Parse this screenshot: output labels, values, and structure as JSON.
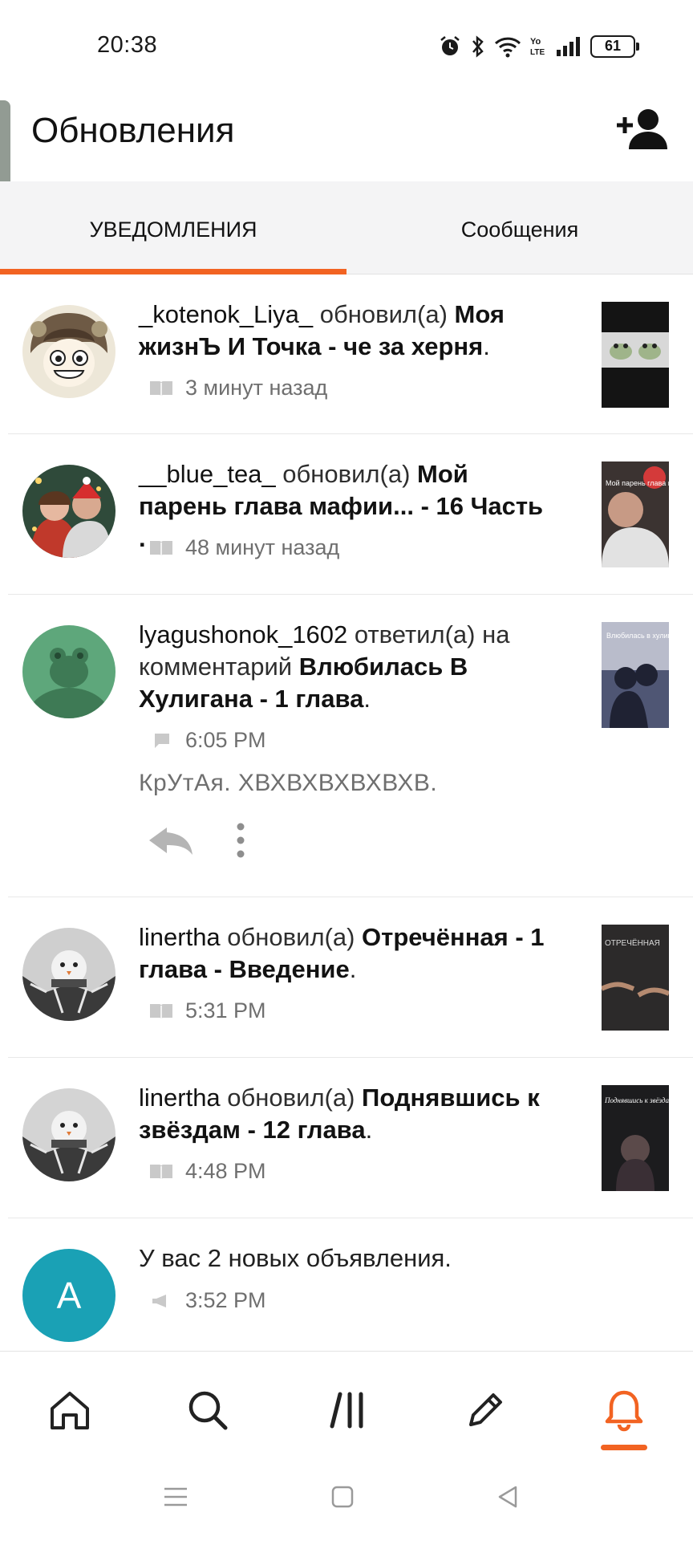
{
  "status_bar": {
    "time": "20:38",
    "battery": "61",
    "icons": [
      "alarm-icon",
      "bluetooth-icon",
      "wifi-icon",
      "volte-icon",
      "signal-icon",
      "battery-icon"
    ]
  },
  "header": {
    "title": "Обновления",
    "action_icon": "add-friend-icon"
  },
  "tabs": [
    {
      "label": "УВЕДОМЛЕНИЯ",
      "active": true
    },
    {
      "label": "Сообщения",
      "active": false
    }
  ],
  "notifications": [
    {
      "user": "_kotenok_Liya_",
      "action": " обновил(а) ",
      "story": "Моя жизнЪ И Точка - че за херня",
      "tail": ".",
      "time": "3 минут назад",
      "meta_icon": "book-icon"
    },
    {
      "user": "__blue_tea_",
      "action": " обновил(а) ",
      "story": "Мой парень глава мафии... - 16 Часть .",
      "tail": "",
      "time": "48 минут назад",
      "meta_icon": "book-icon"
    },
    {
      "user": "lyagushonok_1602",
      "action": " ответил(а) на комментарий ",
      "story": "Влюбилась В Хулигана - 1 глава",
      "tail": ".",
      "time": "6:05 PM",
      "meta_icon": "comment-icon",
      "comment": "КрУтАя. ХВХВХВХВХВХВ."
    },
    {
      "user": "linertha",
      "action": " обновил(а) ",
      "story": "Отречённая - 1 глава - Введение",
      "tail": ".",
      "time": "5:31 PM",
      "meta_icon": "book-icon"
    },
    {
      "user": "linertha",
      "action": " обновил(а) ",
      "story": "Поднявшись к звёздам - 12 глава",
      "tail": ".",
      "time": "4:48 PM",
      "meta_icon": "book-icon"
    },
    {
      "text": "У вас 2 новых объявления.",
      "time": "3:52 PM",
      "meta_icon": "megaphone-icon",
      "avatar_letter": "A"
    }
  ],
  "thumb_text": {
    "t2": "Мой парень глава мафии",
    "t3": "Влюбилась в хулигана",
    "t4": "ОТРЕЧЁННАЯ",
    "t5": "Поднявшись к звёздам"
  },
  "bottom_nav": [
    {
      "icon": "home-icon",
      "active": false
    },
    {
      "icon": "search-icon",
      "active": false
    },
    {
      "icon": "library-icon",
      "active": false
    },
    {
      "icon": "write-icon",
      "active": false
    },
    {
      "icon": "bell-icon",
      "active": true
    }
  ],
  "colors": {
    "accent": "#f26322",
    "tab_bg": "#f4f4f5",
    "announcement_avatar": "#1aa1b5"
  }
}
